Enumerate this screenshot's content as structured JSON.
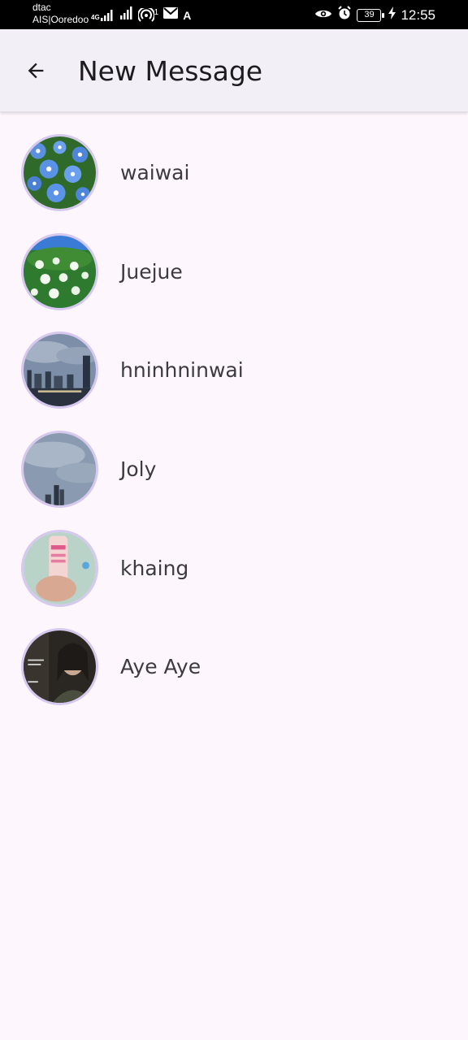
{
  "status_bar": {
    "carrier_line1": "dtac",
    "carrier_line2": "AIS|Ooredoo",
    "network_type": "4G",
    "notification_count": "1",
    "battery_level": "39",
    "time": "12:55"
  },
  "app_bar": {
    "back_icon": "arrow-back-icon",
    "title": "New Message"
  },
  "contacts": [
    {
      "name": "waiwai",
      "avatar": "blue-flowers-photo"
    },
    {
      "name": "Juejue",
      "avatar": "white-flowers-sky-photo"
    },
    {
      "name": "hninhninwai",
      "avatar": "city-skyline-clouds-photo"
    },
    {
      "name": "Joly",
      "avatar": "cloudy-sky-buildings-photo"
    },
    {
      "name": "khaing",
      "avatar": "hand-holding-bottle-photo"
    },
    {
      "name": "Aye Aye",
      "avatar": "portrait-dark-photo"
    }
  ],
  "colors": {
    "background": "#fdf7fd",
    "app_bar": "#f3eff6",
    "avatar_ring": "#d6c8ee",
    "text": "#3d3a42"
  }
}
